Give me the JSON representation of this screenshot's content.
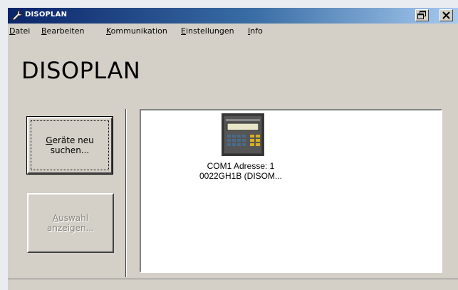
{
  "window": {
    "title": "DISOPLAN"
  },
  "menu": [
    {
      "label": "Datei",
      "mnemonic": "D",
      "rest": "atei"
    },
    {
      "label": "Bearbeiten",
      "mnemonic": "B",
      "rest": "earbeiten"
    },
    {
      "label": "Kommunikation",
      "mnemonic": "K",
      "rest": "ommunikation"
    },
    {
      "label": "Einstellungen",
      "mnemonic": "E",
      "rest": "instellungen"
    },
    {
      "label": "Info",
      "mnemonic": "I",
      "rest": "nfo"
    }
  ],
  "app_title": "DISOPLAN",
  "buttons": {
    "search": {
      "mnemonic": "G",
      "line1_rest": "eräte neu",
      "line2": "suchen...",
      "enabled": true
    },
    "show": {
      "mnemonic": "A",
      "line1_rest": "uswahl",
      "line2": "anzeigen...",
      "enabled": false
    }
  },
  "devices": [
    {
      "line1": "COM1 Adresse: 1",
      "line2": "0022GH1B (DISOM...",
      "icon": "device-controller-icon"
    }
  ],
  "colors": {
    "titlebar_start": "#0a246a",
    "titlebar_end": "#a6caf0",
    "window_bg": "#d4d0c8"
  }
}
